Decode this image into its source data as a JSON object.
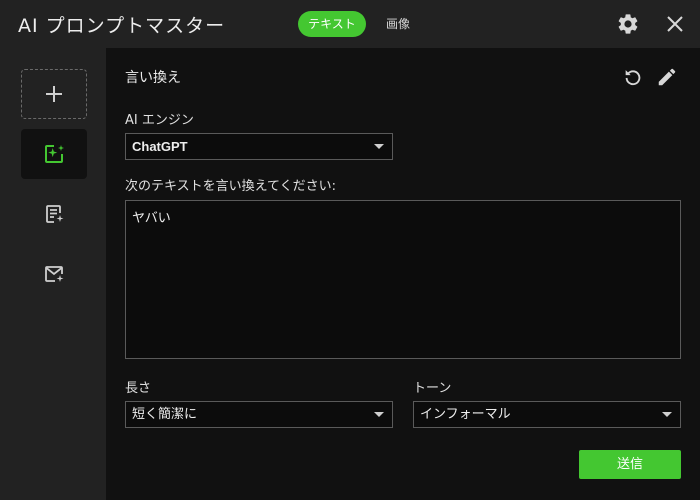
{
  "app": {
    "title": "AI プロンプトマスター"
  },
  "tabs": [
    {
      "label": "テキスト",
      "active": true
    },
    {
      "label": "画像",
      "active": false
    }
  ],
  "titlebar_icons": [
    "gear-icon",
    "close-icon"
  ],
  "sidebar": {
    "items": [
      {
        "icon": "plus-icon"
      },
      {
        "icon": "sparkle-edit-icon",
        "selected": true
      },
      {
        "icon": "document-sparkle-icon"
      },
      {
        "icon": "mail-sparkle-icon"
      }
    ]
  },
  "main": {
    "heading": "言い換え",
    "engine": {
      "label": "AI エンジン",
      "value": "ChatGPT"
    },
    "prompt": {
      "label": "次のテキストを言い換えてください:",
      "value": "ヤバい"
    },
    "length": {
      "label": "長さ",
      "value": "短く簡潔に"
    },
    "tone": {
      "label": "トーン",
      "value": "インフォーマル"
    },
    "send_label": "送信"
  },
  "colors": {
    "accent": "#44c731",
    "panel": "#222222",
    "background": "#111111"
  }
}
